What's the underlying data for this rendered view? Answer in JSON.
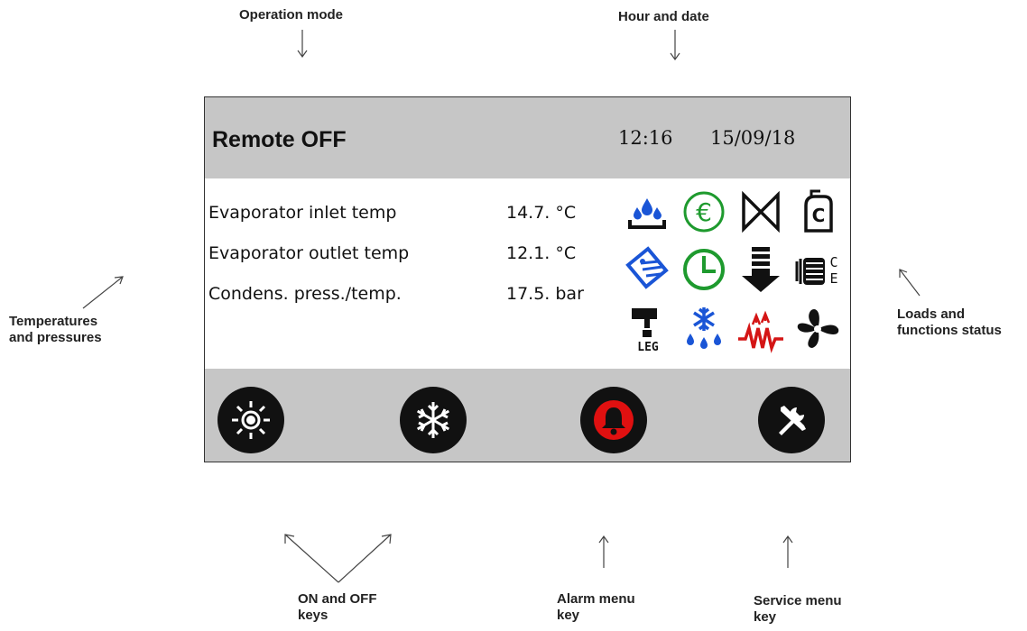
{
  "callouts": {
    "operation_mode": "Operation mode",
    "hour_date": "Hour and date",
    "temps_line1": "Temperatures",
    "temps_line2": "and pressures",
    "loads_line1": "Loads and",
    "loads_line2": "functions status",
    "onoff_line1": "ON and OFF",
    "onoff_line2": "keys",
    "alarm_line1": "Alarm menu",
    "alarm_line2": "key",
    "service_line1": "Service menu",
    "service_line2": "key"
  },
  "header": {
    "mode": "Remote OFF",
    "time": "12:16",
    "date": "15/09/18"
  },
  "readings": [
    {
      "label": "Evaporator inlet temp",
      "value": "14.7.",
      "unit": "°C"
    },
    {
      "label": "Evaporator outlet temp",
      "value": "12.1.",
      "unit": "°C"
    },
    {
      "label": "Condens. press./temp.",
      "value": "17.5.",
      "unit": "bar"
    }
  ],
  "status_icons": {
    "leg_label": "LEG",
    "comp_c_label": "C",
    "comp_c2_label": "C",
    "comp_e_label": "E",
    "names": [
      "water-drops-icon",
      "euro-icon",
      "valve-icon",
      "compressor-c-icon",
      "heat-exchanger-icon",
      "clock-icon",
      "down-arrow-icon",
      "compressor-ce-icon",
      "legionella-tap-icon",
      "defrost-icon",
      "heating-element-icon",
      "fan-icon"
    ]
  },
  "keys": {
    "on_key": "sun-icon",
    "off_key": "snowflake-icon",
    "alarm_key": "bell-icon",
    "service_key": "tools-icon"
  },
  "colors": {
    "bar_gray": "#c6c6c6",
    "icon_blue": "#1a55d6",
    "icon_green": "#1e9a2e",
    "icon_red": "#d41515",
    "alarm_red": "#e01010"
  }
}
